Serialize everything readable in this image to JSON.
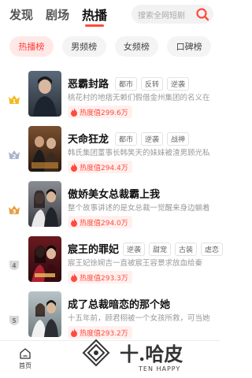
{
  "nav": {
    "tabs": [
      {
        "label": "发现"
      },
      {
        "label": "剧场"
      },
      {
        "label": "热播"
      }
    ],
    "active_tab": "热播",
    "search_placeholder": "搜索全网短剧"
  },
  "chips": [
    {
      "label": "热播榜"
    },
    {
      "label": "男频榜"
    },
    {
      "label": "女频榜"
    },
    {
      "label": "口碑榜"
    }
  ],
  "items": [
    {
      "rank": "1",
      "title": "恶霸封路",
      "tags": [
        "都市",
        "反转",
        "逆袭"
      ],
      "desc": "桃花村的地痞无赖们假借金州集团的名义在",
      "heat": "热度值299.6万"
    },
    {
      "rank": "2",
      "title": "天命狂龙",
      "tags": [
        "都市",
        "逆袭",
        "战神"
      ],
      "desc": "韩氏集团董事长韩笑天的妹妹被渣男顾光私",
      "heat": "热度值294.4万"
    },
    {
      "rank": "3",
      "title": "傲娇美女总裁霸上我",
      "tags": [],
      "desc": "整个故事讲述的是女总裁一觉醒来身边躺着",
      "heat": "热度值294.0万"
    },
    {
      "rank": "4",
      "title": "宸王的罪妃",
      "tags": [
        "逆袭",
        "甜宠",
        "古装",
        "虐恋"
      ],
      "desc": "宸王妃徐婉吉一直被宸王容景求放血给秦",
      "heat": "热度值293.3万"
    },
    {
      "rank": "5",
      "title": "成了总裁暗恋的那个她",
      "tags": [],
      "desc": "十五年前，顾君栩被一个女孩所救，可当她",
      "heat": "热度值293.2万"
    }
  ],
  "bottom": {
    "home_label": "首页"
  },
  "watermark": {
    "name": "十.哈皮",
    "sub": "TEN HAPPY"
  },
  "colors": {
    "accent": "#ff4a3d",
    "chip_active_bg": "#ffe9e7",
    "heat_bg": "#fff0ee"
  }
}
